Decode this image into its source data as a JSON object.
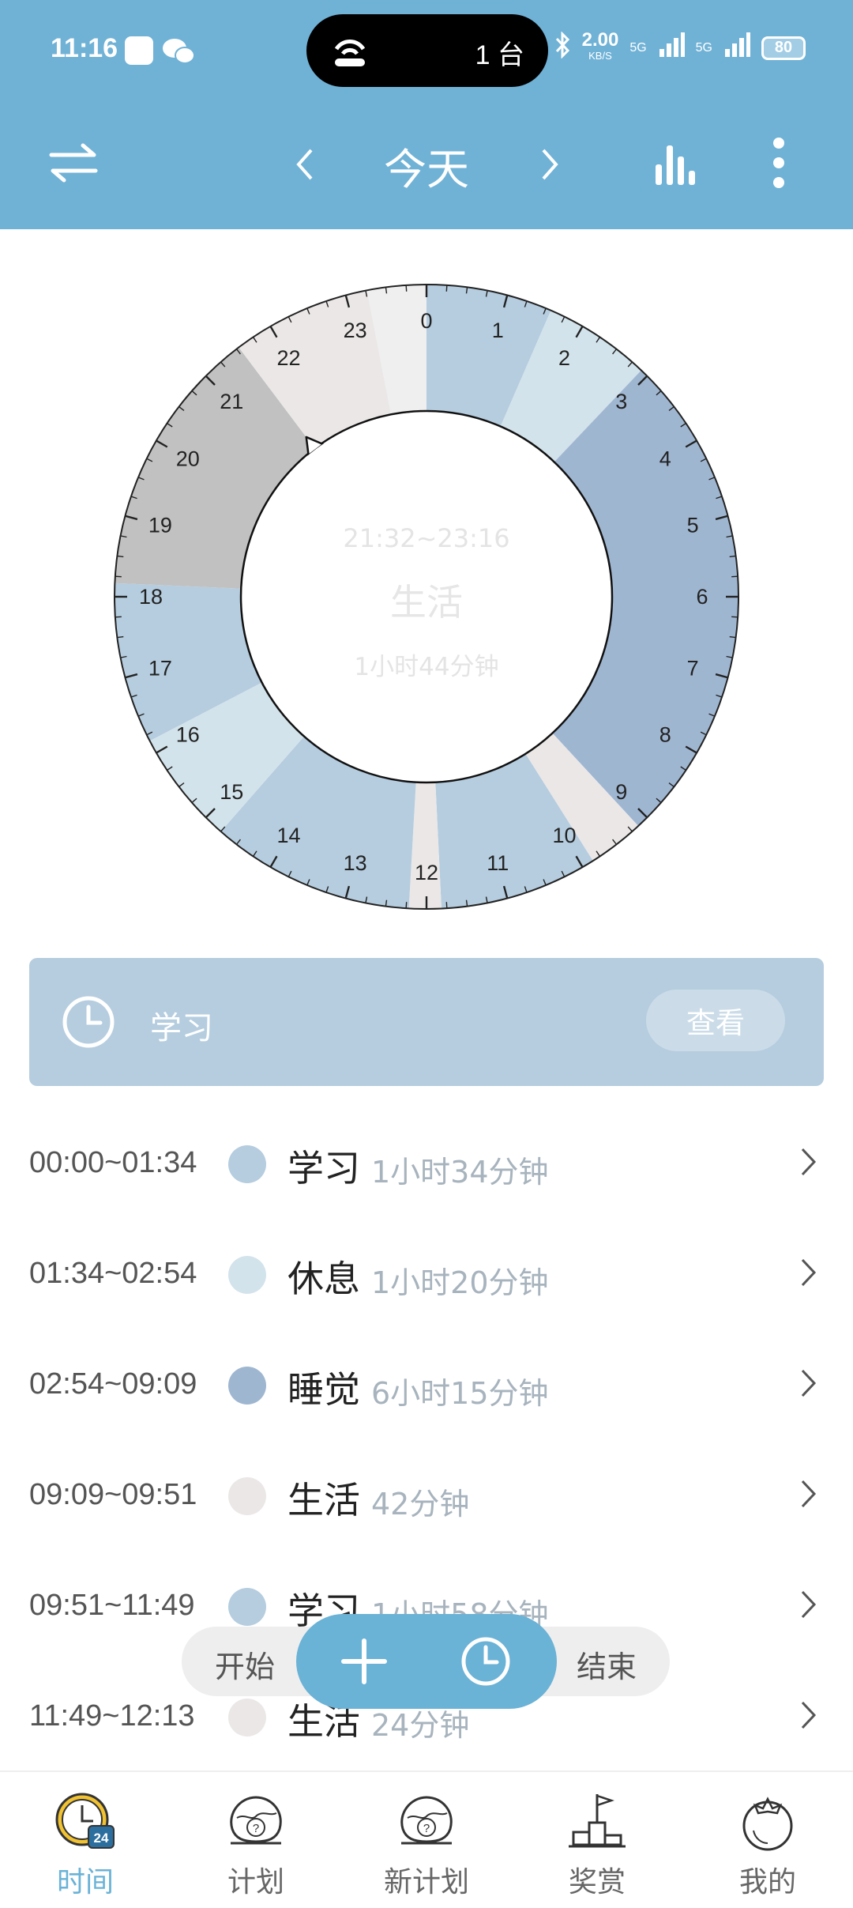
{
  "status_bar": {
    "time": "11:16",
    "island_label": "1 台",
    "net_speed": "2.00",
    "net_unit": "KB/S",
    "signal_1": "5G",
    "signal_2": "5G",
    "battery": "80"
  },
  "header": {
    "title": "今天",
    "icons": [
      "swap-icon",
      "chevron-left-icon",
      "chevron-right-icon",
      "bar-chart-icon",
      "more-vertical-icon"
    ]
  },
  "clock": {
    "hour_labels": [
      "0",
      "1",
      "2",
      "3",
      "4",
      "5",
      "6",
      "7",
      "8",
      "9",
      "10",
      "11",
      "12",
      "13",
      "14",
      "15",
      "16",
      "17",
      "18",
      "19",
      "20",
      "21",
      "22",
      "23"
    ],
    "segments": [
      {
        "start": "00:00",
        "end": "01:34",
        "category": "学习",
        "color": "#b5cddf"
      },
      {
        "start": "01:34",
        "end": "02:54",
        "category": "休息",
        "color": "#d3e3eb"
      },
      {
        "start": "02:54",
        "end": "09:09",
        "category": "睡觉",
        "color": "#9fb6d1"
      },
      {
        "start": "09:09",
        "end": "09:51",
        "category": "生活",
        "color": "#ebe7e7"
      },
      {
        "start": "09:51",
        "end": "11:49",
        "category": "学习",
        "color": "#b5cddf"
      },
      {
        "start": "11:49",
        "end": "12:13",
        "category": "生活",
        "color": "#ebe7e7"
      },
      {
        "start": "12:13",
        "end": "14:45",
        "category": "学习",
        "color": "#b5cddf"
      },
      {
        "start": "14:45",
        "end": "16:10",
        "category": "休息",
        "color": "#d3e3eb"
      },
      {
        "start": "16:10",
        "end": "18:10",
        "category": "学习",
        "color": "#b5cddf"
      },
      {
        "start": "18:10",
        "end": "21:32",
        "category": "",
        "color": "#c1c1c1"
      },
      {
        "start": "21:32",
        "end": "23:16",
        "category": "生活",
        "color": "#ebe7e7"
      },
      {
        "start": "23:16",
        "end": "24:00",
        "category": "",
        "color": "#efefef"
      }
    ],
    "pointer_time": "21:32",
    "center_range": "21:32~23:16",
    "center_name": "生活",
    "center_duration": "1小时44分钟"
  },
  "current_card": {
    "icon": "clock-icon",
    "label": "学习",
    "view_button": "查看",
    "background": "#b5cddf"
  },
  "records": [
    {
      "time": "00:00~01:34",
      "name": "学习",
      "duration": "1小时34分钟",
      "color": "#b5cddf"
    },
    {
      "time": "01:34~02:54",
      "name": "休息",
      "duration": "1小时20分钟",
      "color": "#d3e3eb"
    },
    {
      "time": "02:54~09:09",
      "name": "睡觉",
      "duration": "6小时15分钟",
      "color": "#9fb6d1"
    },
    {
      "time": "09:09~09:51",
      "name": "生活",
      "duration": "42分钟",
      "color": "#ebe7e7"
    },
    {
      "time": "09:51~11:49",
      "name": "学习",
      "duration": "1小时58分钟",
      "color": "#b5cddf"
    },
    {
      "time": "11:49~12:13",
      "name": "生活",
      "duration": "24分钟",
      "color": "#ebe7e7"
    }
  ],
  "fab": {
    "start_label": "开始",
    "end_label": "结束",
    "icons": [
      "plus-icon",
      "clock-icon"
    ],
    "color": "#6ab2d6"
  },
  "bottom_nav": {
    "items": [
      {
        "label": "时间",
        "icon": "clock-24-icon",
        "active": true
      },
      {
        "label": "计划",
        "icon": "brain-icon",
        "active": false
      },
      {
        "label": "新计划",
        "icon": "brain-icon",
        "active": false
      },
      {
        "label": "奖赏",
        "icon": "podium-flag-icon",
        "active": false
      },
      {
        "label": "我的",
        "icon": "tomato-icon",
        "active": false
      }
    ],
    "active_color": "#6ab2d6"
  }
}
